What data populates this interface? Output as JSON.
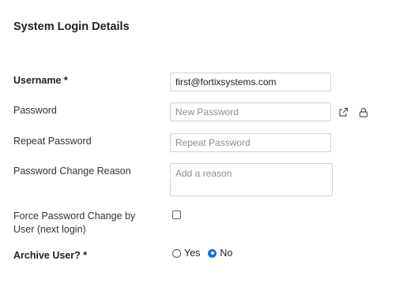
{
  "section": {
    "title": "System Login Details"
  },
  "username": {
    "label": "Username *",
    "value": "first@fortixsystems.com"
  },
  "password": {
    "label": "Password",
    "placeholder": "New Password",
    "icons": [
      "external-link-icon",
      "lock-icon"
    ]
  },
  "repeat_password": {
    "label": "Repeat Password",
    "placeholder": "Repeat Password"
  },
  "change_reason": {
    "label": "Password Change Reason",
    "placeholder": "Add a reason"
  },
  "force_change": {
    "label_line1": "Force Password Change by",
    "label_line2": "User (next login)",
    "checked": false
  },
  "archive_user": {
    "label": "Archive User? *",
    "options": [
      "Yes",
      "No"
    ],
    "selected": "No"
  },
  "colors": {
    "accent": "#1a6fe0",
    "border": "#cfd3d8",
    "icon": "#555555"
  }
}
